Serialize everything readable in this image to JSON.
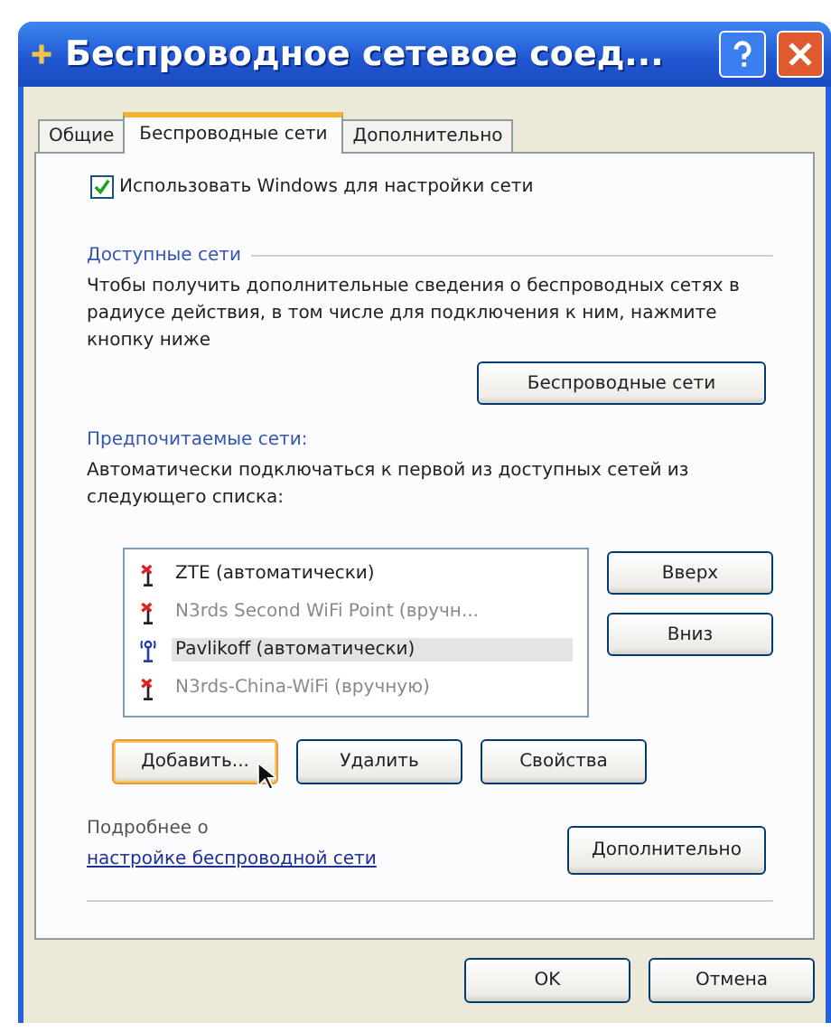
{
  "window": {
    "title": "Беспроводное сетевое соед..."
  },
  "tabs": [
    {
      "label": "Общие",
      "selected": false
    },
    {
      "label": "Беспроводные сети",
      "selected": true
    },
    {
      "label": "Дополнительно",
      "selected": false
    }
  ],
  "use_windows": {
    "label": "Использовать Windows для настройки сети",
    "checked": true
  },
  "available": {
    "legend": "Доступные сети",
    "text": "Чтобы получить дополнительные сведения о беспроводных сетях в радиусе действия, в том числе для подключения к ним, нажмите кнопку ниже",
    "button": "Беспроводные сети"
  },
  "preferred": {
    "legend": "Предпочитаемые сети:",
    "text": "Автоматически подключаться к первой из доступных сетей из следующего списка:",
    "networks": [
      {
        "label": "ZTE (автоматически)",
        "available": false,
        "disabled": false,
        "selected": false
      },
      {
        "label": "N3rds Second WiFi Point (вручн...",
        "available": false,
        "disabled": true,
        "selected": false
      },
      {
        "label": "Pavlikoff (автоматически)",
        "available": true,
        "disabled": false,
        "selected": true
      },
      {
        "label": "N3rds-China-WiFi (вручную)",
        "available": false,
        "disabled": true,
        "selected": false
      }
    ],
    "move_buttons": [
      "Вверх",
      "Вниз"
    ],
    "action_buttons": [
      "Добавить...",
      "Удалить",
      "Свойства"
    ]
  },
  "learn_more": {
    "prefix": "Подробнее о ",
    "link": "настройке беспроводной сети"
  },
  "advanced_button": "Дополнительно",
  "buttons": [
    "OK",
    "Отмена"
  ]
}
